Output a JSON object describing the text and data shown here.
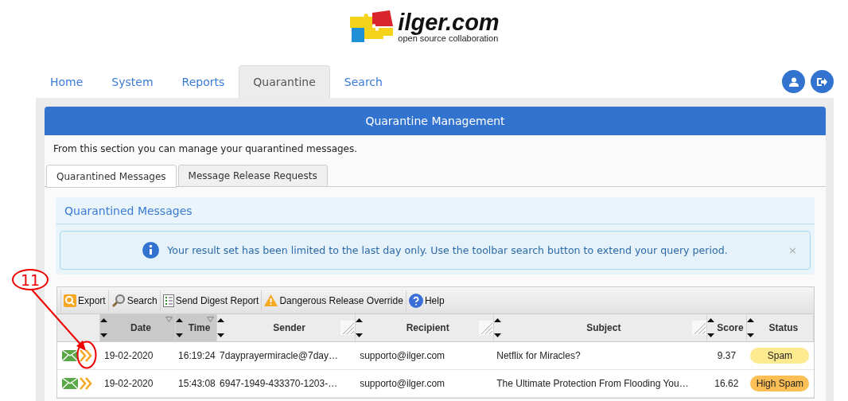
{
  "logo": {
    "name": "ilger.com",
    "tagline": "open source collaboration"
  },
  "nav": {
    "tabs": [
      {
        "label": "Home",
        "selected": false
      },
      {
        "label": "System",
        "selected": false
      },
      {
        "label": "Reports",
        "selected": false
      },
      {
        "label": "Quarantine",
        "selected": true
      },
      {
        "label": "Search",
        "selected": false
      }
    ]
  },
  "panel": {
    "title": "Quarantine Management",
    "description": "From this section you can manage your quarantined messages.",
    "tabs": [
      {
        "label": "Quarantined Messages",
        "selected": true
      },
      {
        "label": "Message Release Requests",
        "selected": false
      }
    ],
    "section_title": "Quarantined Messages",
    "alert": {
      "text": "Your result set has been limited to the last day only. Use the toolbar search button to extend your query period.",
      "close": "×"
    },
    "toolbar": [
      {
        "kind": "export",
        "label": "Export"
      },
      {
        "kind": "search",
        "label": "Search"
      },
      {
        "kind": "digest",
        "label": "Send Digest Report"
      },
      {
        "kind": "warning",
        "label": "Dangerous Release Override"
      },
      {
        "kind": "help",
        "label": "Help"
      }
    ],
    "columns": [
      {
        "label": "Date",
        "sorted": true,
        "resizable": false
      },
      {
        "label": "Time",
        "sorted": true,
        "resizable": false
      },
      {
        "label": "Sender",
        "sorted": false,
        "resizable": true
      },
      {
        "label": "Recipient",
        "sorted": false,
        "resizable": true
      },
      {
        "label": "Subject",
        "sorted": false,
        "resizable": true
      },
      {
        "label": "Score",
        "sorted": false,
        "resizable": false
      },
      {
        "label": "Status",
        "sorted": false,
        "resizable": false
      }
    ],
    "rows": [
      {
        "date": "19-02-2020",
        "time": "16:19:24",
        "sender": "7dayprayermiracle@7day…",
        "recipient": "supporto@ilger.com",
        "subject": "Netflix for Miracles?",
        "score": "9.37",
        "status": "Spam",
        "color": "#ffeb8f"
      },
      {
        "date": "19-02-2020",
        "time": "15:43:08",
        "sender": "6947-1949-433370-1203-…",
        "recipient": "supporto@ilger.com",
        "subject": "The Ultimate Protection From Flooding You…",
        "score": "16.62",
        "status": "High Spam",
        "color": "#fcbf55"
      }
    ]
  },
  "annotation": {
    "label": "11"
  }
}
